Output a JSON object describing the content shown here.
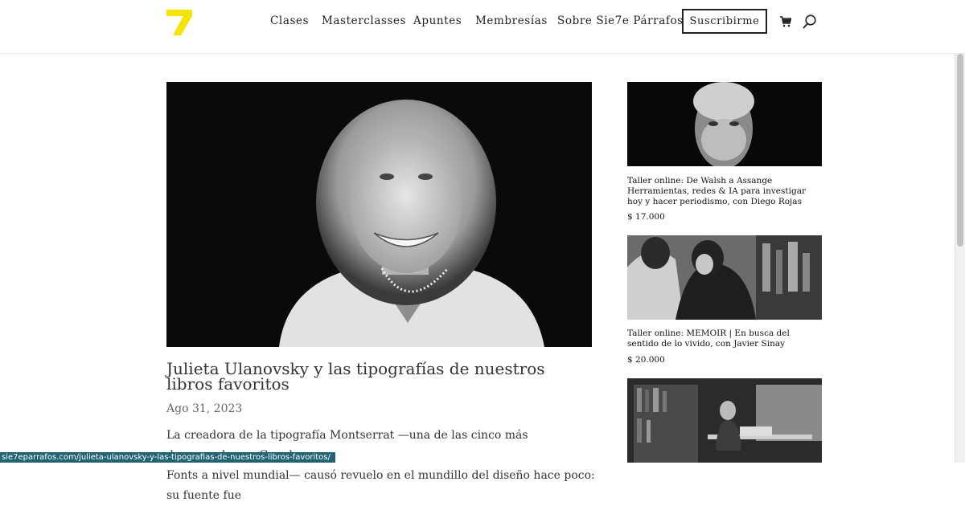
{
  "brand": {
    "logo_glyph": "7",
    "logo_color": "#f5e400"
  },
  "nav": {
    "items": [
      "Clases",
      "Masterclasses",
      "Apuntes",
      "Membresías",
      "Sobre Sie7e Párrafos"
    ],
    "subscribe_label": "Suscribirme"
  },
  "icons": {
    "cart": "cart-icon",
    "search": "search-icon"
  },
  "post": {
    "title": "Julieta Ulanovsky y las tipografías de nuestros libros favoritos",
    "date": "Ago 31, 2023",
    "excerpt_line1": "La creadora de la tipografía Montserrat —una de las cinco más descargadas en Google",
    "excerpt_line2": "Fonts a nivel mundial— causó revuelo en el mundillo del diseño hace poco: su fuente fue"
  },
  "sidebar": {
    "products": [
      {
        "title": "Taller online: De Walsh a Assange Herramientas, redes & IA para investigar hoy y hacer periodismo, con Diego Rojas",
        "price": "$ 17.000"
      },
      {
        "title": "Taller online: MEMOIR | En busca del sentido de lo vivido, con Javier Sinay",
        "price": "$ 20.000"
      },
      {
        "title": "",
        "price": ""
      }
    ]
  },
  "status_bar": {
    "url": "sie7eparrafos.com/julieta-ulanovsky-y-las-tipografias-de-nuestros-libros-favoritos/"
  }
}
